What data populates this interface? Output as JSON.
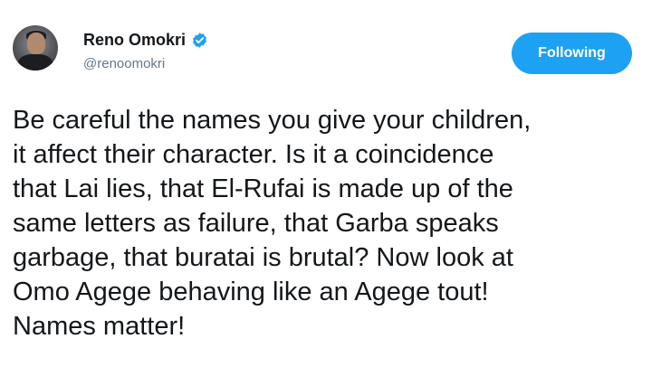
{
  "tweet": {
    "author": {
      "name": "Reno Omokri",
      "handle": "@renoomokri",
      "verified": true
    },
    "follow_button": {
      "label": "Following"
    },
    "text": "Be careful the names you give your children,\nit affect their character. Is it a coincidence\nthat Lai lies, that El-Rufai is made up of the\nsame letters as failure, that Garba speaks\ngarbage, that buratai is brutal? Now look at\nOmo Agege behaving like an Agege tout!\nNames matter!"
  },
  "colors": {
    "accent": "#1da1f2",
    "text": "#14171a",
    "muted": "#657786"
  },
  "icons": {
    "verified": "verified-badge-icon"
  }
}
